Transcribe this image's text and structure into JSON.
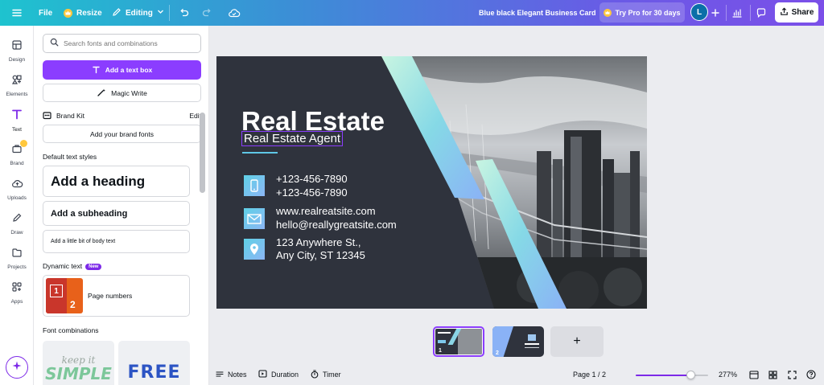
{
  "topbar": {
    "file_label": "File",
    "resize_label": "Resize",
    "editing_label": "Editing",
    "doc_title": "Blue black Elegant Business Card",
    "try_pro_label": "Try Pro for 30 days",
    "avatar_initial": "L",
    "share_label": "Share"
  },
  "rail": {
    "items": [
      {
        "label": "Design",
        "icon": "layout-icon"
      },
      {
        "label": "Elements",
        "icon": "shapes-icon"
      },
      {
        "label": "Text",
        "icon": "text-icon"
      },
      {
        "label": "Brand",
        "icon": "briefcase-icon"
      },
      {
        "label": "Uploads",
        "icon": "cloud-upload-icon"
      },
      {
        "label": "Draw",
        "icon": "pen-icon"
      },
      {
        "label": "Projects",
        "icon": "folder-icon"
      },
      {
        "label": "Apps",
        "icon": "apps-grid-icon"
      }
    ]
  },
  "panel": {
    "search_placeholder": "Search fonts and combinations",
    "add_textbox_label": "Add a text box",
    "magic_write_label": "Magic Write",
    "brand_kit_label": "Brand Kit",
    "edit_label": "Edit",
    "add_brand_fonts_label": "Add your brand fonts",
    "default_styles_title": "Default text styles",
    "heading_label": "Add a heading",
    "subheading_label": "Add a subheading",
    "body_label": "Add a little bit of body text",
    "dynamic_text_title": "Dynamic text",
    "new_badge": "New",
    "page_numbers_label": "Page numbers",
    "page_numbers_thumb": [
      "1",
      "2"
    ],
    "font_combinations_title": "Font combinations",
    "combo_1_top": "keep it",
    "combo_1_bottom": "SIMPLE",
    "combo_2": "FREE"
  },
  "card": {
    "headline": "Real Estate",
    "subtitle": "Real Estate Agent",
    "phone_1": "+123-456-7890",
    "phone_2": "+123-456-7890",
    "website": "www.realreatsite.com",
    "email": "hello@reallygreatsite.com",
    "address_1": "123 Anywhere St.,",
    "address_2": "Any City, ST 12345"
  },
  "pages": {
    "thumb_1_number": "1",
    "thumb_2_number": "2",
    "add_page_label": "+"
  },
  "footer": {
    "notes_label": "Notes",
    "duration_label": "Duration",
    "timer_label": "Timer",
    "page_indicator": "Page 1 / 2",
    "zoom_level": "277%",
    "zoom_slider_fraction": 0.75
  },
  "colors": {
    "accent_purple": "#8b3dff",
    "card_background": "#2f333d",
    "card_accent_gradient_start": "#5fd1e6",
    "card_accent_gradient_end": "#8cb6f5"
  }
}
